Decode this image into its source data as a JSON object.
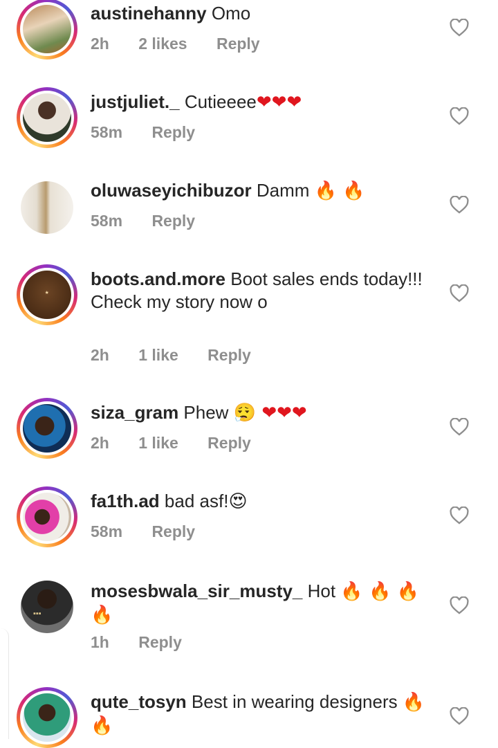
{
  "comments": [
    {
      "username": "austinehanny",
      "text": "Omo",
      "extra": "",
      "time": "2h",
      "likes": "2 likes",
      "reply": "Reply"
    },
    {
      "username": "justjuliet._",
      "text": "Cutieeee",
      "extra": "❤❤❤",
      "time": "58m",
      "likes": "",
      "reply": "Reply"
    },
    {
      "username": "oluwaseyichibuzor",
      "text": "Damm",
      "extra": "🔥 🔥",
      "time": "58m",
      "likes": "",
      "reply": "Reply"
    },
    {
      "username": "boots.and.more",
      "text": "Boot sales ends today!!!",
      "text2": "Check my story now o",
      "time": "2h",
      "likes": "1 like",
      "reply": "Reply"
    },
    {
      "username": "siza_gram",
      "text": "Phew",
      "extra": "😮‍💨 ❤❤❤",
      "time": "2h",
      "likes": "1 like",
      "reply": "Reply"
    },
    {
      "username": "fa1th.ad",
      "text": "bad asf!",
      "extra": "😍",
      "time": "58m",
      "likes": "",
      "reply": "Reply"
    },
    {
      "username": "mosesbwala_sir_musty_",
      "text": "Hot",
      "extra": "🔥 🔥 🔥 🔥",
      "time": "1h",
      "likes": "",
      "reply": "Reply"
    },
    {
      "username": "qute_tosyn",
      "text": "Best in wearing designers",
      "extra": "🔥 🔥",
      "time": "",
      "likes": "",
      "reply": ""
    }
  ],
  "avatar_logo_text": "BOOTS.AND.MORE",
  "icons": {
    "like": "heart-outline-icon"
  },
  "colors": {
    "text": "#262626",
    "meta": "#8e8e8e",
    "story_ring": "#d62976",
    "heart_red": "#e0161e"
  }
}
